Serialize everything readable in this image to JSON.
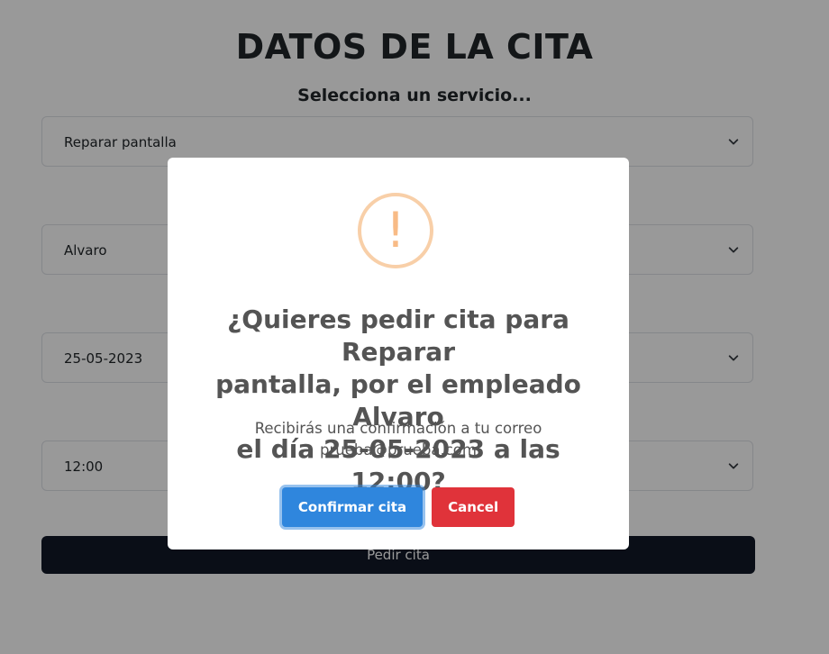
{
  "form": {
    "title": "DATOS DE LA CITA",
    "service_label": "Selecciona un servicio...",
    "service_value": "Reparar pantalla",
    "employee_value": "Alvaro",
    "date_value": "25-05-2023",
    "time_value": "12:00",
    "submit_label": "Pedir cita"
  },
  "dialog": {
    "icon": "warning-icon",
    "icon_glyph": "!",
    "title_line1": "¿Quieres pedir cita para Reparar",
    "title_line2": "pantalla, por el empleado Alvaro",
    "title_line3": "el día 25-05-2023 a las 12:00?",
    "text_line1": "Recibirás una confirmación a tu correo",
    "text_line2": "prueba@prueba.com",
    "confirm_label": "Confirmar cita",
    "cancel_label": "Cancel"
  },
  "colors": {
    "confirm_button": "#2f86dd",
    "cancel_button": "#e0333a",
    "submit_button": "#111827",
    "warning_icon": "#f8bb86"
  }
}
